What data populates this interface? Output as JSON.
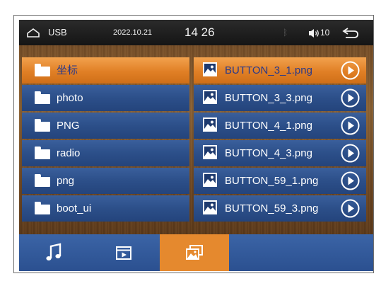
{
  "status_bar": {
    "source": "USB",
    "date": "2022.10.21",
    "time": "14 26",
    "volume": "10"
  },
  "folders": [
    {
      "label": "坐标",
      "selected": true
    },
    {
      "label": "photo",
      "selected": false
    },
    {
      "label": "PNG",
      "selected": false
    },
    {
      "label": "radio",
      "selected": false
    },
    {
      "label": "png",
      "selected": false
    },
    {
      "label": "boot_ui",
      "selected": false
    }
  ],
  "files": [
    {
      "label": "BUTTON_3_1.png",
      "selected": true
    },
    {
      "label": "BUTTON_3_3.png",
      "selected": false
    },
    {
      "label": "BUTTON_4_1.png",
      "selected": false
    },
    {
      "label": "BUTTON_4_3.png",
      "selected": false
    },
    {
      "label": "BUTTON_59_1.png",
      "selected": false
    },
    {
      "label": "BUTTON_59_3.png",
      "selected": false
    }
  ],
  "bottom_tabs": [
    {
      "name": "music-tab",
      "icon": "music-note-icon",
      "active": false
    },
    {
      "name": "video-tab",
      "icon": "video-icon",
      "active": false
    },
    {
      "name": "photo-tab",
      "icon": "photo-icon",
      "active": true
    },
    {
      "name": "empty-tab",
      "icon": "",
      "active": false
    }
  ],
  "colors": {
    "list_blue": "#2c4f89",
    "selected_orange": "#e07f25",
    "selected_text": "#2a3a8a",
    "status_bar": "#1e1e1e",
    "bottom_bar_blue": "#2f5696",
    "active_tab_orange": "#e5892e"
  }
}
